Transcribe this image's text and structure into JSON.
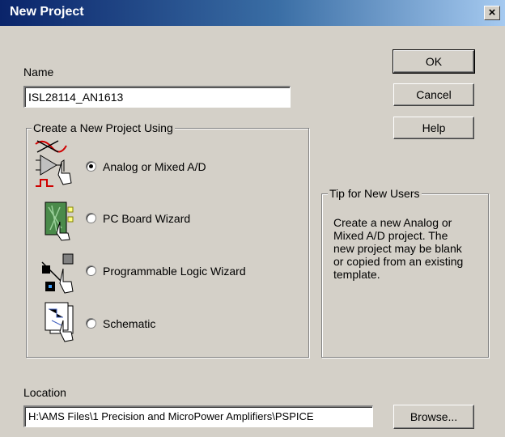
{
  "window": {
    "title": "New Project",
    "close_glyph": "×"
  },
  "name_field": {
    "label": "Name",
    "value": "ISL28114_AN1613"
  },
  "buttons": {
    "ok": "OK",
    "cancel": "Cancel",
    "help": "Help",
    "browse": "Browse..."
  },
  "project_type": {
    "group_title": "Create a New Project Using",
    "options": [
      {
        "label": "Analog or Mixed A/D",
        "selected": true,
        "icon": "analog-circuit-icon"
      },
      {
        "label": "PC Board Wizard",
        "selected": false,
        "icon": "pcb-board-icon"
      },
      {
        "label": "Programmable Logic Wizard",
        "selected": false,
        "icon": "programmable-logic-icon"
      },
      {
        "label": "Schematic",
        "selected": false,
        "icon": "schematic-icon"
      }
    ]
  },
  "tip": {
    "title": "Tip for New Users",
    "lines": [
      "Create a new Analog or",
      "Mixed A/D project.  The",
      "new project may be blank",
      "or copied from an existing",
      "template."
    ]
  },
  "location": {
    "label": "Location",
    "value": "H:\\AMS Files\\1 Precision and MicroPower Amplifiers\\PSPICE"
  },
  "colors": {
    "title_bar_start": "#0a246a",
    "title_bar_end": "#a6caf0",
    "dialog_bg": "#d4d0c8"
  }
}
